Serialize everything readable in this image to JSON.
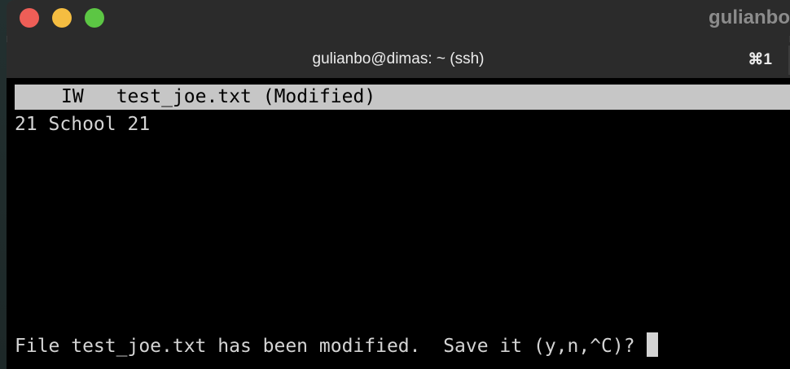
{
  "window": {
    "host_fragment": "gulianbo",
    "tab_title": "gulianbo@dimas: ~ (ssh)",
    "tab_shortcut": "⌘1"
  },
  "editor": {
    "status_mode": "IW",
    "status_filename": "test_joe.txt (Modified)",
    "lines": [
      "21 School 21"
    ],
    "prompt": "File test_joe.txt has been modified.  Save it (y,n,^C)?"
  },
  "colors": {
    "close": "#ee5e57",
    "minimize": "#f5bd41",
    "zoom": "#5cc644",
    "status_bar_bg": "#c6c6c6",
    "terminal_bg": "#000000"
  },
  "icons": {
    "close": "close-button-icon",
    "minimize": "minimize-button-icon",
    "zoom": "zoom-button-icon",
    "cursor": "terminal-cursor-icon"
  }
}
